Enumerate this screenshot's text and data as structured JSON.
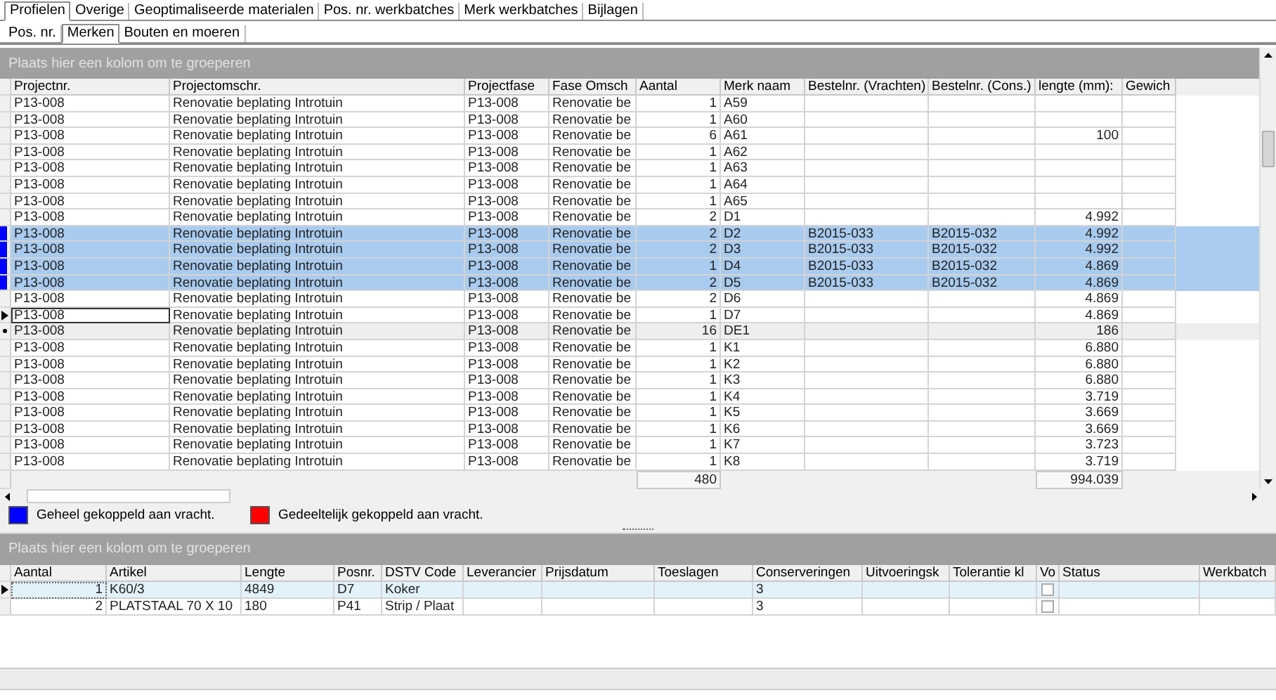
{
  "tabs": [
    {
      "label": "Profielen",
      "selected": true
    },
    {
      "label": "Overige",
      "selected": false
    },
    {
      "label": "Geoptimaliseerde materialen",
      "selected": false
    },
    {
      "label": "Pos. nr. werkbatches",
      "selected": false
    },
    {
      "label": "Merk werkbatches",
      "selected": false
    },
    {
      "label": "Bijlagen",
      "selected": false
    }
  ],
  "subtabs": [
    {
      "label": "Pos. nr.",
      "selected": false
    },
    {
      "label": "Merken",
      "selected": true
    },
    {
      "label": "Bouten en moeren",
      "selected": false
    }
  ],
  "merken_grid": {
    "group_panel": "Plaats hier een kolom om te groeperen",
    "columns": [
      "Projectnr.",
      "Projectomschr.",
      "Projectfase",
      "Fase Omsch",
      "Aantal",
      "Merk naam",
      "Bestelnr. (Vrachten)",
      "Bestelnr. (Cons.)",
      "lengte (mm):",
      "Gewich"
    ],
    "rows": [
      {
        "projectnr": "P13-008",
        "omschr": "Renovatie beplating Introtuin",
        "fase": "P13-008",
        "fase_omsch": "Renovatie be",
        "aantal": "1",
        "merk": "A59",
        "selected": false,
        "current": false,
        "hover": false
      },
      {
        "projectnr": "P13-008",
        "omschr": "Renovatie beplating Introtuin",
        "fase": "P13-008",
        "fase_omsch": "Renovatie be",
        "aantal": "1",
        "merk": "A60",
        "selected": false,
        "current": false,
        "hover": false
      },
      {
        "projectnr": "P13-008",
        "omschr": "Renovatie beplating Introtuin",
        "fase": "P13-008",
        "fase_omsch": "Renovatie be",
        "aantal": "6",
        "merk": "A61",
        "lengte": "100",
        "selected": false,
        "current": false,
        "hover": false
      },
      {
        "projectnr": "P13-008",
        "omschr": "Renovatie beplating Introtuin",
        "fase": "P13-008",
        "fase_omsch": "Renovatie be",
        "aantal": "1",
        "merk": "A62",
        "selected": false,
        "current": false,
        "hover": false
      },
      {
        "projectnr": "P13-008",
        "omschr": "Renovatie beplating Introtuin",
        "fase": "P13-008",
        "fase_omsch": "Renovatie be",
        "aantal": "1",
        "merk": "A63",
        "selected": false,
        "current": false,
        "hover": false
      },
      {
        "projectnr": "P13-008",
        "omschr": "Renovatie beplating Introtuin",
        "fase": "P13-008",
        "fase_omsch": "Renovatie be",
        "aantal": "1",
        "merk": "A64",
        "selected": false,
        "current": false,
        "hover": false
      },
      {
        "projectnr": "P13-008",
        "omschr": "Renovatie beplating Introtuin",
        "fase": "P13-008",
        "fase_omsch": "Renovatie be",
        "aantal": "1",
        "merk": "A65",
        "selected": false,
        "current": false,
        "hover": false
      },
      {
        "projectnr": "P13-008",
        "omschr": "Renovatie beplating Introtuin",
        "fase": "P13-008",
        "fase_omsch": "Renovatie be",
        "aantal": "2",
        "merk": "D1",
        "lengte": "4.992",
        "selected": false,
        "current": false,
        "hover": false
      },
      {
        "projectnr": "P13-008",
        "omschr": "Renovatie beplating Introtuin",
        "fase": "P13-008",
        "fase_omsch": "Renovatie be",
        "aantal": "2",
        "merk": "D2",
        "best_v": "B2015-033",
        "best_c": "B2015-032",
        "lengte": "4.992",
        "selected": true,
        "current": false,
        "hover": false,
        "color": "#0000ff"
      },
      {
        "projectnr": "P13-008",
        "omschr": "Renovatie beplating Introtuin",
        "fase": "P13-008",
        "fase_omsch": "Renovatie be",
        "aantal": "2",
        "merk": "D3",
        "best_v": "B2015-033",
        "best_c": "B2015-032",
        "lengte": "4.992",
        "selected": true,
        "current": false,
        "hover": false,
        "color": "#0000ff"
      },
      {
        "projectnr": "P13-008",
        "omschr": "Renovatie beplating Introtuin",
        "fase": "P13-008",
        "fase_omsch": "Renovatie be",
        "aantal": "1",
        "merk": "D4",
        "best_v": "B2015-033",
        "best_c": "B2015-032",
        "lengte": "4.869",
        "selected": true,
        "current": false,
        "hover": false,
        "color": "#0000ff"
      },
      {
        "projectnr": "P13-008",
        "omschr": "Renovatie beplating Introtuin",
        "fase": "P13-008",
        "fase_omsch": "Renovatie be",
        "aantal": "2",
        "merk": "D5",
        "best_v": "B2015-033",
        "best_c": "B2015-032",
        "lengte": "4.869",
        "selected": true,
        "current": false,
        "hover": false,
        "color": "#0000ff"
      },
      {
        "projectnr": "P13-008",
        "omschr": "Renovatie beplating Introtuin",
        "fase": "P13-008",
        "fase_omsch": "Renovatie be",
        "aantal": "2",
        "merk": "D6",
        "lengte": "4.869",
        "selected": false,
        "current": false,
        "hover": false
      },
      {
        "projectnr": "P13-008",
        "omschr": "Renovatie beplating Introtuin",
        "fase": "P13-008",
        "fase_omsch": "Renovatie be",
        "aantal": "1",
        "merk": "D7",
        "lengte": "4.869",
        "selected": false,
        "current": true,
        "hover": false
      },
      {
        "projectnr": "P13-008",
        "omschr": "Renovatie beplating Introtuin",
        "fase": "P13-008",
        "fase_omsch": "Renovatie be",
        "aantal": "16",
        "merk": "DE1",
        "lengte": "186",
        "selected": false,
        "current": false,
        "hover": true
      },
      {
        "projectnr": "P13-008",
        "omschr": "Renovatie beplating Introtuin",
        "fase": "P13-008",
        "fase_omsch": "Renovatie be",
        "aantal": "1",
        "merk": "K1",
        "lengte": "6.880",
        "selected": false,
        "current": false,
        "hover": false
      },
      {
        "projectnr": "P13-008",
        "omschr": "Renovatie beplating Introtuin",
        "fase": "P13-008",
        "fase_omsch": "Renovatie be",
        "aantal": "1",
        "merk": "K2",
        "lengte": "6.880",
        "selected": false,
        "current": false,
        "hover": false
      },
      {
        "projectnr": "P13-008",
        "omschr": "Renovatie beplating Introtuin",
        "fase": "P13-008",
        "fase_omsch": "Renovatie be",
        "aantal": "1",
        "merk": "K3",
        "lengte": "6.880",
        "selected": false,
        "current": false,
        "hover": false
      },
      {
        "projectnr": "P13-008",
        "omschr": "Renovatie beplating Introtuin",
        "fase": "P13-008",
        "fase_omsch": "Renovatie be",
        "aantal": "1",
        "merk": "K4",
        "lengte": "3.719",
        "selected": false,
        "current": false,
        "hover": false
      },
      {
        "projectnr": "P13-008",
        "omschr": "Renovatie beplating Introtuin",
        "fase": "P13-008",
        "fase_omsch": "Renovatie be",
        "aantal": "1",
        "merk": "K5",
        "lengte": "3.669",
        "selected": false,
        "current": false,
        "hover": false
      },
      {
        "projectnr": "P13-008",
        "omschr": "Renovatie beplating Introtuin",
        "fase": "P13-008",
        "fase_omsch": "Renovatie be",
        "aantal": "1",
        "merk": "K6",
        "lengte": "3.669",
        "selected": false,
        "current": false,
        "hover": false
      },
      {
        "projectnr": "P13-008",
        "omschr": "Renovatie beplating Introtuin",
        "fase": "P13-008",
        "fase_omsch": "Renovatie be",
        "aantal": "1",
        "merk": "K7",
        "lengte": "3.723",
        "selected": false,
        "current": false,
        "hover": false
      },
      {
        "projectnr": "P13-008",
        "omschr": "Renovatie beplating Introtuin",
        "fase": "P13-008",
        "fase_omsch": "Renovatie be",
        "aantal": "1",
        "merk": "K8",
        "lengte": "3.719",
        "selected": false,
        "current": false,
        "hover": false
      }
    ],
    "totals": {
      "aantal": "480",
      "lengte": "994.039"
    }
  },
  "legend": [
    {
      "label": "Geheel gekoppeld aan vracht.",
      "color": "#0000ff"
    },
    {
      "label": "Gedeeltelijk gekoppeld aan vracht.",
      "color": "#ff0000"
    }
  ],
  "detail_grid": {
    "group_panel": "Plaats hier een kolom om te groeperen",
    "columns": [
      "Aantal",
      "Artikel",
      "Lengte",
      "Posnr.",
      "DSTV Code",
      "Leverancier",
      "Prijsdatum",
      "Toeslagen",
      "Conserveringen",
      "Uitvoeringsk",
      "Tolerantie kl",
      "Vo",
      "Status",
      "Werkbatch"
    ],
    "rows": [
      {
        "aantal": "1",
        "artikel": "K60/3",
        "lengte": "4849",
        "posnr": "D7",
        "dstv": "Koker",
        "conserveringen": "3",
        "vo_checked": false,
        "current": true
      },
      {
        "aantal": "2",
        "artikel": "PLATSTAAL 70 X 10",
        "lengte": "180",
        "posnr": "P41",
        "dstv": "Strip / Plaat",
        "conserveringen": "3",
        "vo_checked": false,
        "current": false
      }
    ]
  }
}
